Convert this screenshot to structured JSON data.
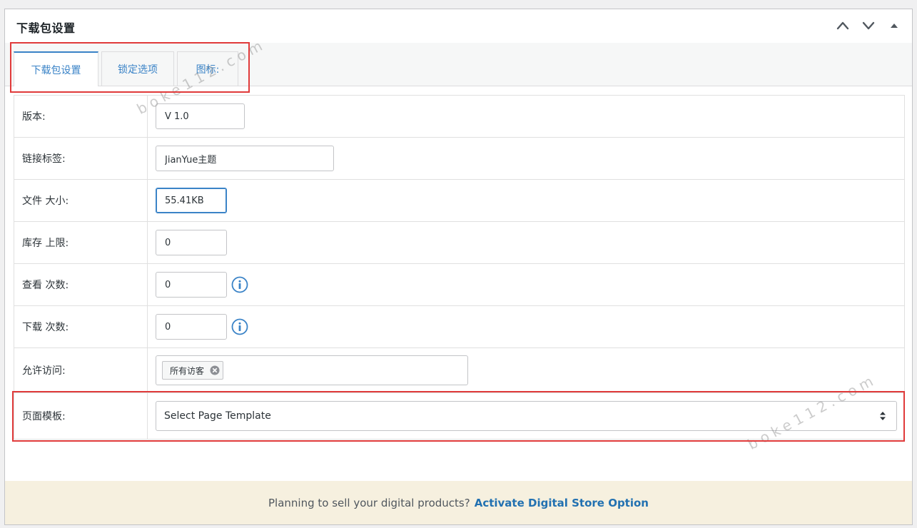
{
  "metabox": {
    "title": "下载包设置",
    "controls": {
      "move_up_icon": "chevron-up-icon",
      "move_down_icon": "chevron-down-icon",
      "toggle_icon": "triangle-up-icon"
    }
  },
  "tabs": [
    {
      "label": "下载包设置",
      "active": true
    },
    {
      "label": "锁定选项",
      "active": false
    },
    {
      "label": "图标:",
      "active": false
    }
  ],
  "fields": {
    "version": {
      "label": "版本:",
      "value": "V 1.0"
    },
    "link_label": {
      "label": "链接标签:",
      "value": "JianYue主题"
    },
    "file_size": {
      "label": "文件 大小:",
      "value": "55.41KB"
    },
    "stock_limit": {
      "label": "库存 上限:",
      "value": "0"
    },
    "view_count": {
      "label": "查看 次数:",
      "value": "0"
    },
    "download_count": {
      "label": "下载 次数:",
      "value": "0"
    },
    "allow_access": {
      "label": "允许访问:",
      "tag": "所有访客"
    },
    "page_template": {
      "label": "页面模板:",
      "value": "Select Page Template"
    }
  },
  "footer": {
    "text": "Planning to sell your digital products?",
    "link": "Activate Digital Store Option"
  },
  "watermark": "boke112.com",
  "colors": {
    "accent": "#3a83c7",
    "highlight_box": "#e03a3a",
    "footer_bg": "#f6f0df",
    "link": "#2271b1"
  }
}
